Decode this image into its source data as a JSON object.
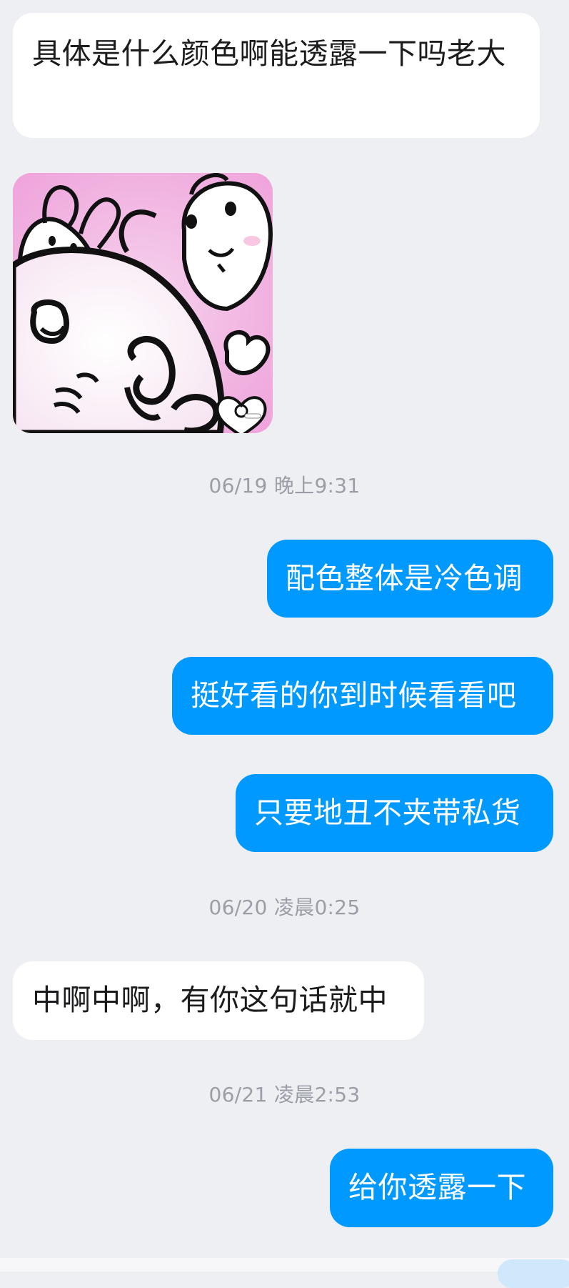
{
  "messages": {
    "m1": "具体是什么颜色啊能透露一下吗老大",
    "m2": "配色整体是冷色调",
    "m3": "挺好看的你到时候看看吧",
    "m4": "只要地丑不夹带私货",
    "m5": "中啊中啊，有你这句话就中",
    "m6": "给你透露一下"
  },
  "timestamps": {
    "t1": "06/19 晚上9:31",
    "t2": "06/20 凌晨0:25",
    "t3": "06/21 凌晨2:53"
  },
  "colors": {
    "background": "#eeeff3",
    "incoming_bubble": "#ffffff",
    "outgoing_bubble": "#0099ff",
    "timestamp_text": "#9b9ea6"
  }
}
